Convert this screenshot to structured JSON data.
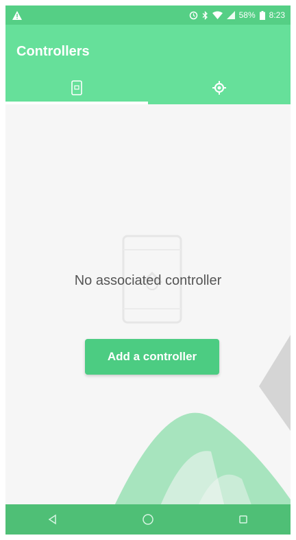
{
  "status_bar": {
    "battery_percent": "58%",
    "time": "8:23",
    "icons": [
      "warning-icon",
      "alarm-icon",
      "bluetooth-icon",
      "wifi-icon",
      "cell-signal-icon",
      "battery-icon"
    ]
  },
  "app_bar": {
    "title": "Controllers",
    "tabs": [
      {
        "name": "controllers-tab",
        "icon": "phone-device-icon",
        "active": true
      },
      {
        "name": "settings-tab",
        "icon": "gear-icon",
        "active": false
      }
    ]
  },
  "content": {
    "empty_message": "No associated controller",
    "add_button_label": "Add a controller"
  },
  "nav_bar": {
    "buttons": [
      "back-icon",
      "home-icon",
      "recents-icon"
    ]
  },
  "colors": {
    "status_bar": "#55cf85",
    "app_bar": "#66e09a",
    "accent": "#4ccc82",
    "nav_bar": "#4fbf76",
    "background": "#f6f6f6"
  }
}
